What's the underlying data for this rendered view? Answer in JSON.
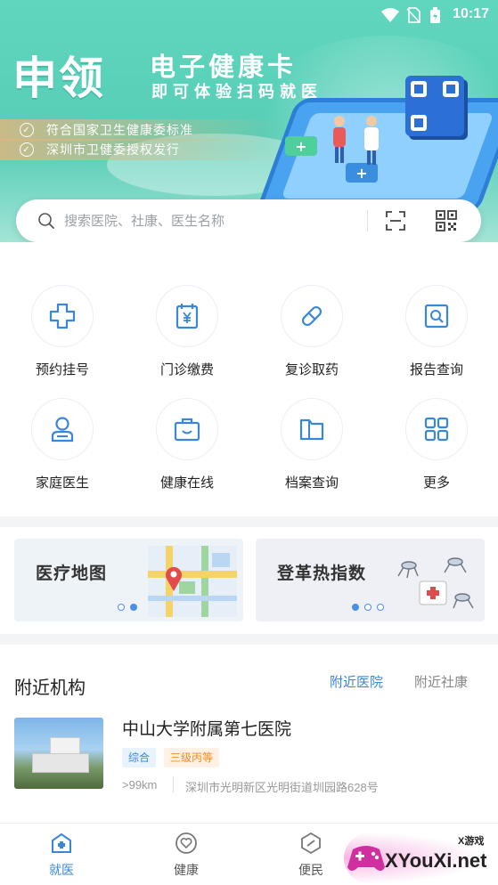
{
  "statusbar": {
    "time": "10:17"
  },
  "banner": {
    "title": "申领",
    "subtitle": "电子健康卡",
    "tagline": "即可体验扫码就医",
    "certs": [
      "符合国家卫生健康委标准",
      "深圳市卫健委授权发行"
    ]
  },
  "search": {
    "placeholder": "搜索医院、社康、医生名称"
  },
  "services": [
    {
      "label": "预约挂号",
      "icon": "plus-cross-icon"
    },
    {
      "label": "门诊缴费",
      "icon": "yuan-bill-icon"
    },
    {
      "label": "复诊取药",
      "icon": "pill-icon"
    },
    {
      "label": "报告查询",
      "icon": "report-search-icon"
    },
    {
      "label": "家庭医生",
      "icon": "doctor-icon"
    },
    {
      "label": "健康在线",
      "icon": "briefcase-icon"
    },
    {
      "label": "档案查询",
      "icon": "folder-icon"
    },
    {
      "label": "更多",
      "icon": "grid-icon"
    }
  ],
  "promos": [
    {
      "title": "医疗地图"
    },
    {
      "title": "登革热指数"
    }
  ],
  "nearby": {
    "title": "附近机构",
    "tabs": [
      "附近医院",
      "附近社康"
    ],
    "hospital": {
      "name": "中山大学附属第七医院",
      "tags": [
        "综合",
        "三级丙等"
      ],
      "distance": ">99km",
      "address": "深圳市光明新区光明街道圳园路628号"
    }
  },
  "bottomnav": {
    "items": [
      {
        "label": "就医",
        "active": true
      },
      {
        "label": "健康",
        "active": false
      },
      {
        "label": "便民",
        "active": false
      }
    ]
  },
  "watermark": {
    "brand": "XYouXi.net",
    "small": "X游戏"
  },
  "colors": {
    "accent": "#3a86d8",
    "banner_teal": "#5fd6bd",
    "tag_blue": "#e8f3fd",
    "tag_orange": "#fff1e3"
  }
}
